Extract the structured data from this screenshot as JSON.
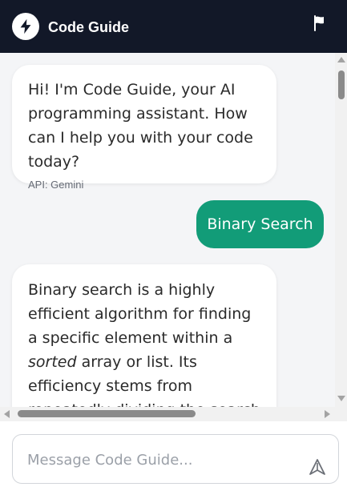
{
  "header": {
    "title": "Code Guide",
    "logo_icon": "bolt-icon",
    "flag_icon": "flag-icon",
    "background": "#121828"
  },
  "messages": [
    {
      "role": "assistant",
      "text": "Hi! I'm Code Guide, your AI programming assistant. How can I help you with your code today?",
      "meta": "API: Gemini"
    },
    {
      "role": "user",
      "text": "Binary Search"
    },
    {
      "role": "assistant",
      "text_before": "Binary search is a highly efficient algorithm for finding a specific element within a ",
      "text_emphasis": "sorted",
      "text_after": " array or list. Its efficiency stems from repeatedly dividing the search interval in half. If the target"
    }
  ],
  "composer": {
    "placeholder": "Message Code Guide...",
    "value": "",
    "send_icon": "send-icon"
  },
  "colors": {
    "accent": "#129c78",
    "header": "#121828",
    "background": "#f4f5f7"
  }
}
